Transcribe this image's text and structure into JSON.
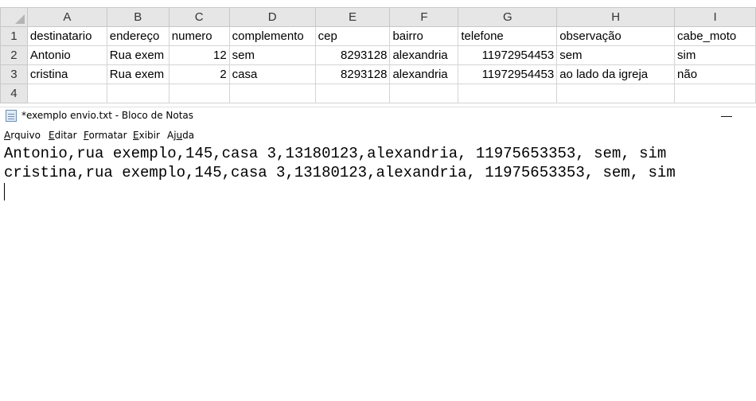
{
  "spreadsheet": {
    "columns": [
      "A",
      "B",
      "C",
      "D",
      "E",
      "F",
      "G",
      "H",
      "I"
    ],
    "rows": [
      {
        "num": "1",
        "cells": [
          "destinatario",
          "endereço",
          "numero",
          "complemento",
          "cep",
          "bairro",
          "telefone",
          "observação",
          "cabe_moto"
        ]
      },
      {
        "num": "2",
        "cells": [
          "Antonio",
          "Rua exem",
          "12",
          "sem",
          "8293128",
          "alexandria",
          "11972954453",
          "sem",
          "sim"
        ]
      },
      {
        "num": "3",
        "cells": [
          "cristina",
          "Rua exem",
          "2",
          "casa",
          "8293128",
          "alexandria",
          "11972954453",
          "ao lado da igreja",
          "não"
        ]
      },
      {
        "num": "4",
        "cells": [
          "",
          "",
          "",
          "",
          "",
          "",
          "",
          "",
          ""
        ]
      }
    ]
  },
  "notepad": {
    "title": "*exemplo envio.txt - Bloco de Notas",
    "minimize_label": "—",
    "menu": [
      {
        "mnemonic": "A",
        "rest": "rquivo"
      },
      {
        "mnemonic": "E",
        "rest": "ditar"
      },
      {
        "mnemonic": "F",
        "rest": "ormatar"
      },
      {
        "mnemonic": "E",
        "rest": "xibir"
      },
      {
        "mnemonic": "",
        "rest": "Aj",
        "mnemonic2": "u",
        "rest2": "da"
      }
    ],
    "lines": [
      "Antonio,rua exemplo,145,casa 3,13180123,alexandria, 11975653353, sem, sim",
      "cristina,rua exemplo,145,casa 3,13180123,alexandria, 11975653353, sem, sim"
    ]
  }
}
